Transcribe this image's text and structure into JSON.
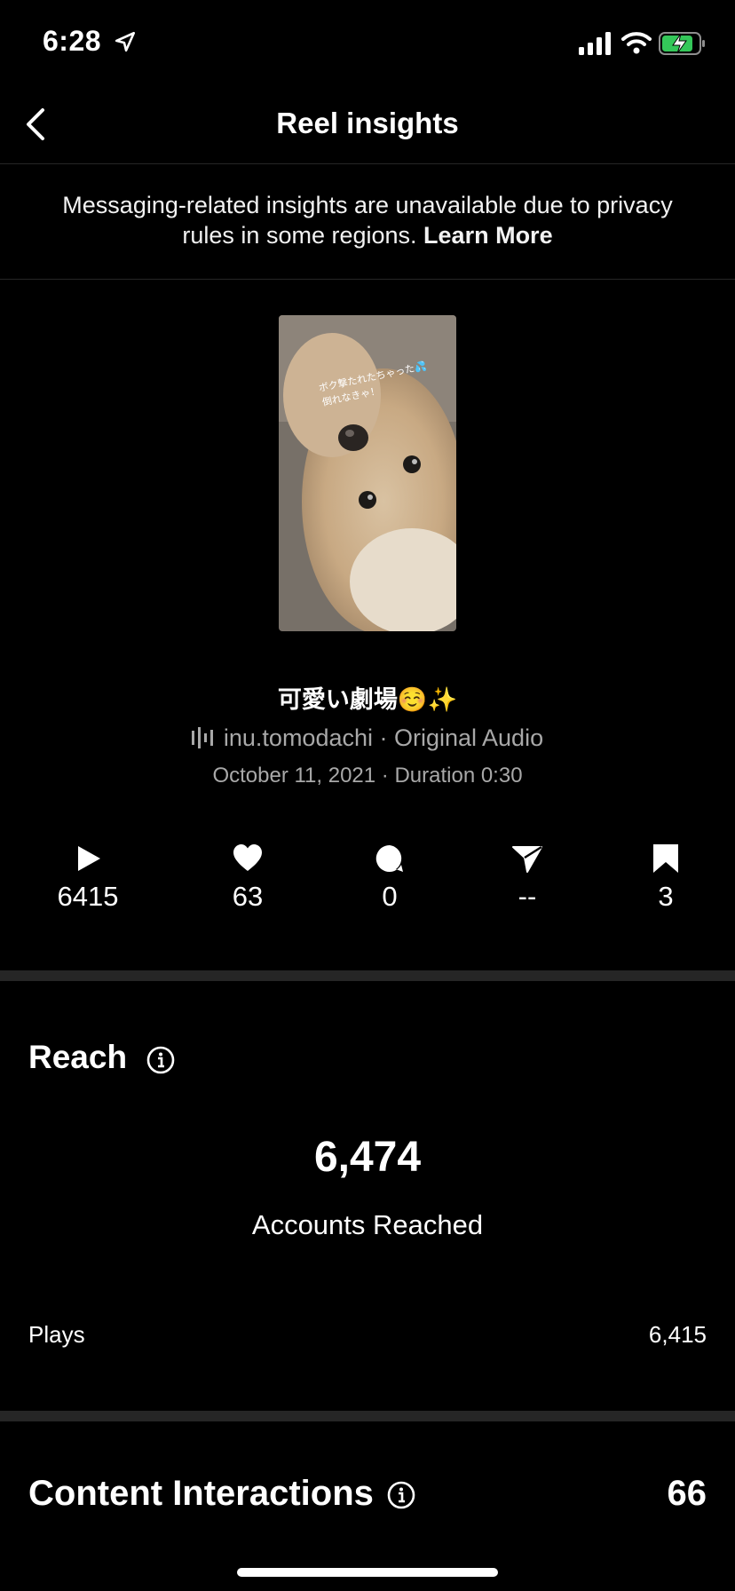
{
  "status_bar": {
    "time": "6:28"
  },
  "header": {
    "title": "Reel insights"
  },
  "notice": {
    "text": "Messaging-related insights are unavailable due to privacy rules in some regions.",
    "link": "Learn More"
  },
  "thumbnail": {
    "overlay_line1": "ボク撃たれたちゃった💦",
    "overlay_line2": "倒れなきゃ！"
  },
  "reel": {
    "title": "可愛い劇場☺️✨",
    "audio": "inu.tomodachi · Original Audio",
    "date": "October 11, 2021 · Duration 0:30"
  },
  "stats": [
    {
      "icon": "play-icon",
      "value": "6415"
    },
    {
      "icon": "heart-icon",
      "value": "63"
    },
    {
      "icon": "comment-icon",
      "value": "0"
    },
    {
      "icon": "share-icon",
      "value": "--"
    },
    {
      "icon": "bookmark-icon",
      "value": "3"
    }
  ],
  "reach": {
    "title": "Reach",
    "count": "6,474",
    "label": "Accounts Reached",
    "plays_label": "Plays",
    "plays_value": "6,415"
  },
  "content_interactions": {
    "title": "Content Interactions",
    "value": "66"
  },
  "colors": {
    "background": "#000000",
    "divider": "#262626",
    "secondary_text": "#a8a8a8",
    "battery_green": "#34c759"
  }
}
